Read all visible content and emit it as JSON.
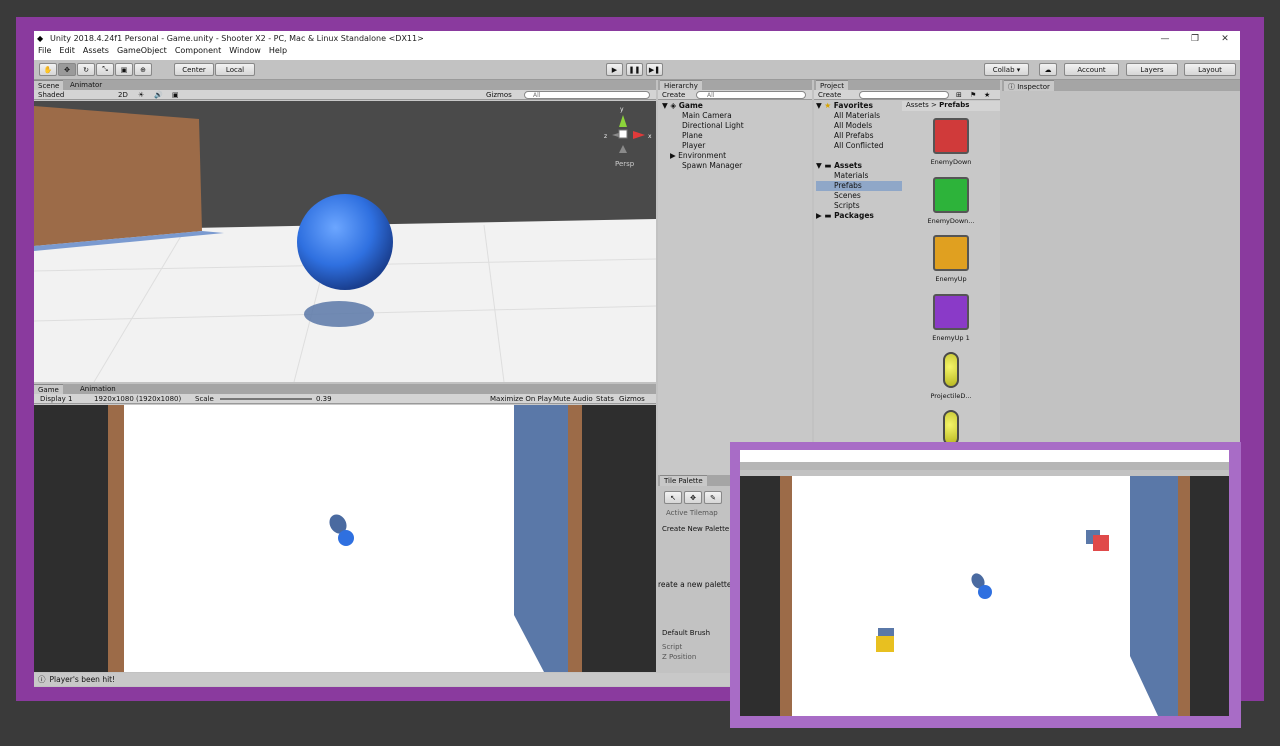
{
  "window": {
    "title": "Unity 2018.4.24f1 Personal - Game.unity - Shooter X2 - PC, Mac & Linux Standalone <DX11>",
    "controls": [
      "—",
      "❐",
      "✕"
    ]
  },
  "menu": [
    "File",
    "Edit",
    "Assets",
    "GameObject",
    "Component",
    "Window",
    "Help"
  ],
  "toolbar": {
    "pivot": "Center",
    "space": "Local",
    "collab": "Collab ▾",
    "account": "Account",
    "layers": "Layers",
    "layout": "Layout"
  },
  "scene": {
    "tabs": [
      "Scene",
      "Animator"
    ],
    "shading": "Shaded",
    "mode2d": "2D",
    "gizmos": "Gizmos",
    "search_placeholder": "All",
    "persp": "Persp",
    "axes": {
      "y": "y",
      "x": "x",
      "z": "z"
    }
  },
  "game": {
    "tabs": [
      "Game",
      "Animation"
    ],
    "display": "Display 1",
    "resolution": "1920x1080 (1920x1080)",
    "scale_label": "Scale",
    "scale_value": "0.39",
    "toggles": [
      "Maximize On Play",
      "Mute Audio",
      "Stats",
      "Gizmos"
    ]
  },
  "hierarchy": {
    "tab": "Hierarchy",
    "create": "Create",
    "search_placeholder": "All",
    "scene": "Game",
    "items": [
      "Main Camera",
      "Directional Light",
      "Plane",
      "Player",
      "Environment",
      "Spawn Manager"
    ]
  },
  "project": {
    "tab": "Project",
    "create": "Create",
    "favorites_label": "Favorites",
    "favorites": [
      "All Materials",
      "All Models",
      "All Prefabs",
      "All Conflicted"
    ],
    "assets_label": "Assets",
    "assets": [
      "Materials",
      "Prefabs",
      "Scenes",
      "Scripts"
    ],
    "packages_label": "Packages",
    "breadcrumb_root": "Assets",
    "breadcrumb_sep": ">",
    "breadcrumb_current": "Prefabs",
    "prefabs": [
      {
        "name": "EnemyDown",
        "color": "#d03a3a"
      },
      {
        "name": "EnemyDown...",
        "color": "#2db33a"
      },
      {
        "name": "EnemyUp",
        "color": "#e0a020"
      },
      {
        "name": "EnemyUp 1",
        "color": "#8a3ac8"
      },
      {
        "name": "ProjectileD...",
        "color": "#e8e84a"
      }
    ]
  },
  "inspector": {
    "tab": "Inspector"
  },
  "tile_palette": {
    "tab": "Tile Palette",
    "active_tilemap": "Active Tilemap",
    "create_palette": "Create New Palette",
    "message": "reate a new palette in",
    "default_brush": "Default Brush",
    "script": "Script",
    "position": "Z Position"
  },
  "status": {
    "message": "Player's been hit!"
  },
  "colors": {
    "purple_frame": "#8a3a9e",
    "overlay": "#a86cc6",
    "sphere": "#2f70e0",
    "wall": "#9c6b48",
    "water": "#5a78a8"
  }
}
